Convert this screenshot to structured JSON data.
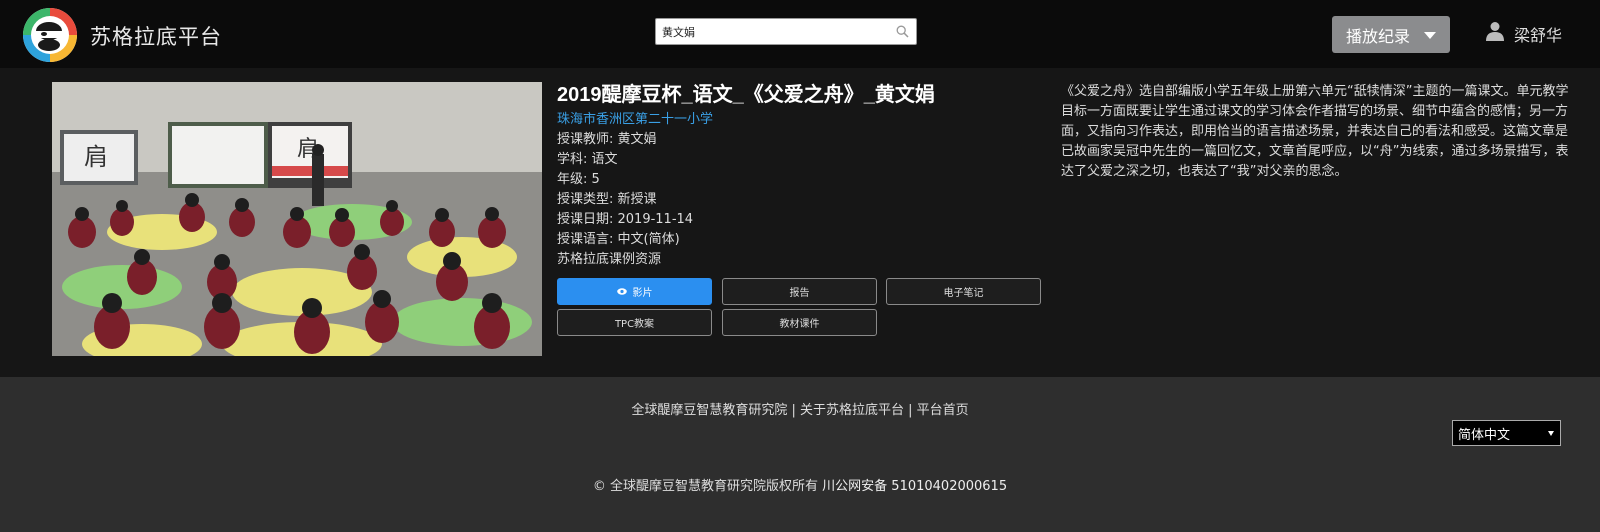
{
  "header": {
    "brand": "苏格拉底平台",
    "search": {
      "value": "黄文娟"
    },
    "record_label": "播放纪录",
    "user_name": "梁舒华"
  },
  "lesson": {
    "title": "2019醍摩豆杯_语文_《父爱之舟》_黄文娟",
    "school": "珠海市香洲区第二十一小学",
    "meta": [
      "授课教师: 黄文娟",
      "学科: 语文",
      "年级: 5",
      "授课类型: 新授课",
      "授课日期: 2019-11-14",
      "授课语言: 中文(简体)",
      "苏格拉底课例资源"
    ],
    "buttons": {
      "video": "影片",
      "report": "报告",
      "notes": "电子笔记",
      "tpc": "TPC教案",
      "materials": "教材课件"
    },
    "description": "《父爱之舟》选自部编版小学五年级上册第六单元“舐犊情深”主题的一篇课文。单元教学目标一方面既要让学生通过课文的学习体会作者描写的场景、细节中蕴含的感情；另一方面，又指向习作表达，即用恰当的语言描述场景，并表达自己的看法和感受。这篇文章是已故画家吴冠中先生的一篇回忆文，文章首尾呼应，以“舟”为线索，通过多场景描写，表达了父爱之深之切，也表达了“我”对父亲的思念。",
    "board_char": "肩"
  },
  "footer": {
    "links": [
      "全球醍摩豆智慧教育研究院",
      "关于苏格拉底平台",
      "平台首页"
    ],
    "separator": " | ",
    "language": "简体中文",
    "copyright": "© 全球醍摩豆智慧教育研究院版权所有",
    "icp": "川公网安备 51010402000615"
  },
  "colors": {
    "accent": "#2b8ff0",
    "school_link": "#3aa0e6",
    "header_bg": "#0b0b0b",
    "main_bg": "#161616",
    "footer_bg": "#2e2e2e"
  }
}
